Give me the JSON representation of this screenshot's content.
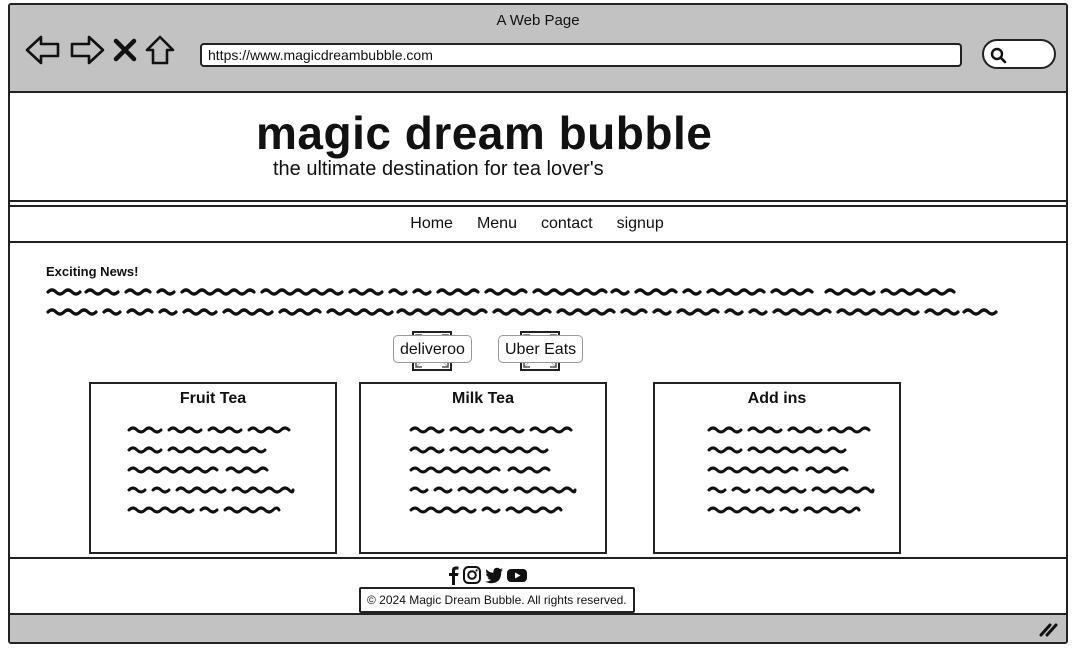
{
  "window": {
    "title": "A Web Page",
    "url": "https://www.magicdreambubble.com"
  },
  "header": {
    "title": "magic dream bubble",
    "tagline": "the ultimate destination for tea lover's"
  },
  "nav": {
    "items": [
      "Home",
      "Menu",
      "contact",
      "signup"
    ]
  },
  "news": {
    "title": "Exciting News!"
  },
  "delivery": {
    "deliveroo": "deliveroo",
    "ubereats": "Uber Eats"
  },
  "cards": [
    {
      "title": "Fruit Tea"
    },
    {
      "title": "Milk Tea"
    },
    {
      "title": "Add ins"
    }
  ],
  "footer": {
    "social_icons": [
      "facebook-icon",
      "instagram-icon",
      "twitter-icon",
      "youtube-icon"
    ],
    "copyright": "© 2024 Magic Dream Bubble. All rights reserved."
  },
  "colors": {
    "chrome": "#c2c2c2",
    "stroke": "#222222"
  }
}
